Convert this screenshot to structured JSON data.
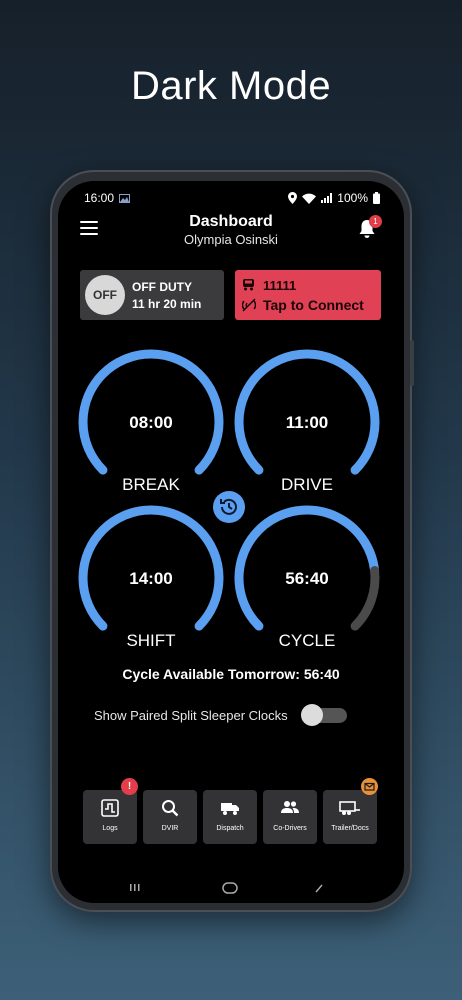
{
  "promo": {
    "headline": "Dark Mode"
  },
  "statusbar": {
    "time": "16:00",
    "battery": "100%"
  },
  "header": {
    "title": "Dashboard",
    "driver_name": "Olympia Osinski",
    "notification_count": "1"
  },
  "duty_status": {
    "badge": "OFF",
    "label": "OFF DUTY",
    "time_in_status": "11 hr 20 min"
  },
  "connection": {
    "vehicle_id": "11111",
    "action_label": "Tap to Connect",
    "color": "#e04154"
  },
  "clocks": [
    {
      "label": "BREAK",
      "value": "08:00",
      "fill_fraction": 1.0
    },
    {
      "label": "DRIVE",
      "value": "11:00",
      "fill_fraction": 1.0
    },
    {
      "label": "SHIFT",
      "value": "14:00",
      "fill_fraction": 1.0
    },
    {
      "label": "CYCLE",
      "value": "56:40",
      "fill_fraction": 0.81
    }
  ],
  "clock_colors": {
    "active": "#5b9ff0",
    "used": "#4a4a4a"
  },
  "cycle_tomorrow": "Cycle Available Tomorrow: 56:40",
  "split_sleeper": {
    "label": "Show Paired Split Sleeper Clocks",
    "enabled": false
  },
  "bottom_nav": [
    {
      "label": "Logs",
      "icon": "logs-icon",
      "badge": "!",
      "badge_color": "#e23d4b"
    },
    {
      "label": "DVIR",
      "icon": "search-icon"
    },
    {
      "label": "Dispatch",
      "icon": "truck-icon"
    },
    {
      "label": "Co-Drivers",
      "icon": "people-icon"
    },
    {
      "label": "Trailer/Docs",
      "icon": "trailer-icon",
      "badge": "envelope",
      "badge_color": "#e8913a"
    }
  ]
}
